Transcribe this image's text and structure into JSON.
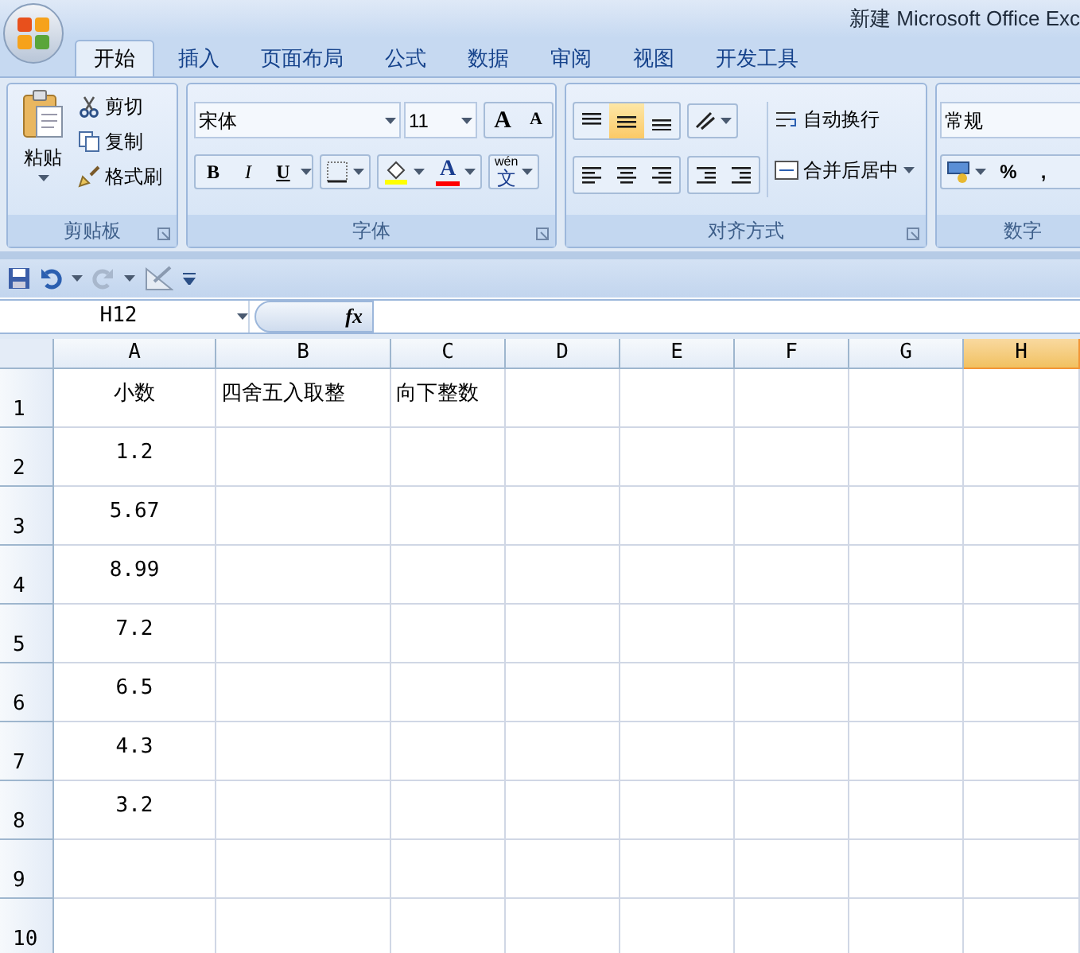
{
  "window": {
    "title": "新建 Microsoft Office Exc"
  },
  "tabs": [
    {
      "label": "开始",
      "selected": true
    },
    {
      "label": "插入",
      "selected": false
    },
    {
      "label": "页面布局",
      "selected": false
    },
    {
      "label": "公式",
      "selected": false
    },
    {
      "label": "数据",
      "selected": false
    },
    {
      "label": "审阅",
      "selected": false
    },
    {
      "label": "视图",
      "selected": false
    },
    {
      "label": "开发工具",
      "selected": false
    }
  ],
  "ribbon": {
    "clipboard": {
      "label": "剪贴板",
      "paste": "粘贴",
      "cut": "剪切",
      "copy": "复制",
      "format_painter": "格式刷"
    },
    "font": {
      "label": "字体",
      "font_name": "宋体",
      "font_size": "11",
      "grow": "A",
      "shrink": "A",
      "bold": "B",
      "italic": "I",
      "underline": "U",
      "font_color": "A",
      "phonetic_top": "wén",
      "phonetic": "文"
    },
    "alignment": {
      "label": "对齐方式",
      "vertical": [
        {
          "kind": "top",
          "selected": false
        },
        {
          "kind": "middle",
          "selected": true
        },
        {
          "kind": "bottom",
          "selected": false
        }
      ],
      "wrap_text": "自动换行",
      "merge_center": "合并后居中"
    },
    "number": {
      "label": "数字",
      "format": "常规",
      "percent": "%",
      "comma": ","
    }
  },
  "formula_bar": {
    "name_box": "H12",
    "function_label": "fx"
  },
  "columns": [
    {
      "label": "A",
      "selected": false
    },
    {
      "label": "B",
      "selected": false
    },
    {
      "label": "C",
      "selected": false
    },
    {
      "label": "D",
      "selected": false
    },
    {
      "label": "E",
      "selected": false
    },
    {
      "label": "F",
      "selected": false
    },
    {
      "label": "G",
      "selected": false
    },
    {
      "label": "H",
      "selected": true
    }
  ],
  "rows": [
    {
      "label": "1",
      "cells": [
        "小数",
        "四舍五入取整",
        "向下整数"
      ]
    },
    {
      "label": "2",
      "cells": [
        "1.2"
      ]
    },
    {
      "label": "3",
      "cells": [
        "5.67"
      ]
    },
    {
      "label": "4",
      "cells": [
        "8.99"
      ]
    },
    {
      "label": "5",
      "cells": [
        "7.2"
      ]
    },
    {
      "label": "6",
      "cells": [
        "6.5"
      ]
    },
    {
      "label": "7",
      "cells": [
        "4.3"
      ]
    },
    {
      "label": "8",
      "cells": [
        "3.2"
      ]
    },
    {
      "label": "9"
    },
    {
      "label": "10"
    }
  ]
}
